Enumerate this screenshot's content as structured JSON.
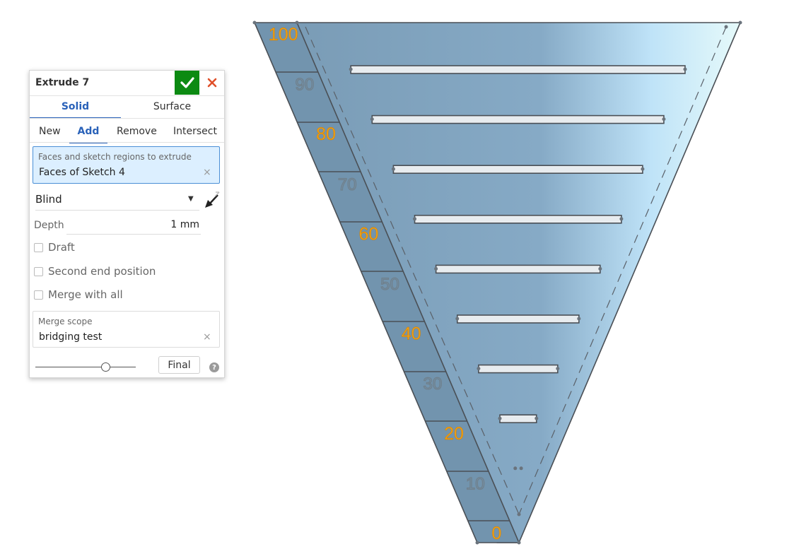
{
  "dialog": {
    "title": "Extrude 7",
    "tabs": [
      "Solid",
      "Surface"
    ],
    "operations": [
      "New",
      "Add",
      "Remove",
      "Intersect"
    ],
    "selected_tab": "Solid",
    "selected_operation": "Add",
    "faces": {
      "label": "Faces and sketch regions to extrude",
      "value": "Faces of Sketch 4",
      "clear": "×"
    },
    "end_type": {
      "value": "Blind",
      "options_visible": [
        "Blind"
      ]
    },
    "depth": {
      "label": "Depth",
      "value": "1 mm"
    },
    "checkboxes": [
      {
        "label": "Draft",
        "checked": false
      },
      {
        "label": "Second end position",
        "checked": false
      },
      {
        "label": "Merge with all",
        "checked": false
      }
    ],
    "merge_scope": {
      "label": "Merge scope",
      "value": "bridging test",
      "clear": "×"
    },
    "slider": {
      "value": 0.7
    },
    "final_label": "Final",
    "help": "?",
    "accept_icon": "checkmark-icon",
    "cancel_icon": "close-icon",
    "colors": {
      "accent": "#2a62b9",
      "accept": "#0c8a12",
      "cancel": "#e0502a",
      "field_bg": "#dcefff"
    }
  },
  "model": {
    "labels": {
      "major": [
        "100",
        "80",
        "60",
        "40",
        "20",
        "0"
      ],
      "minor": [
        "90",
        "70",
        "50",
        "30",
        "10"
      ]
    },
    "colors": {
      "face": "#7a9bb5",
      "face_light": "#d8f2fb",
      "edge": "#4a4f55",
      "label": "#f0a014",
      "slot": "#e8ecef"
    }
  }
}
